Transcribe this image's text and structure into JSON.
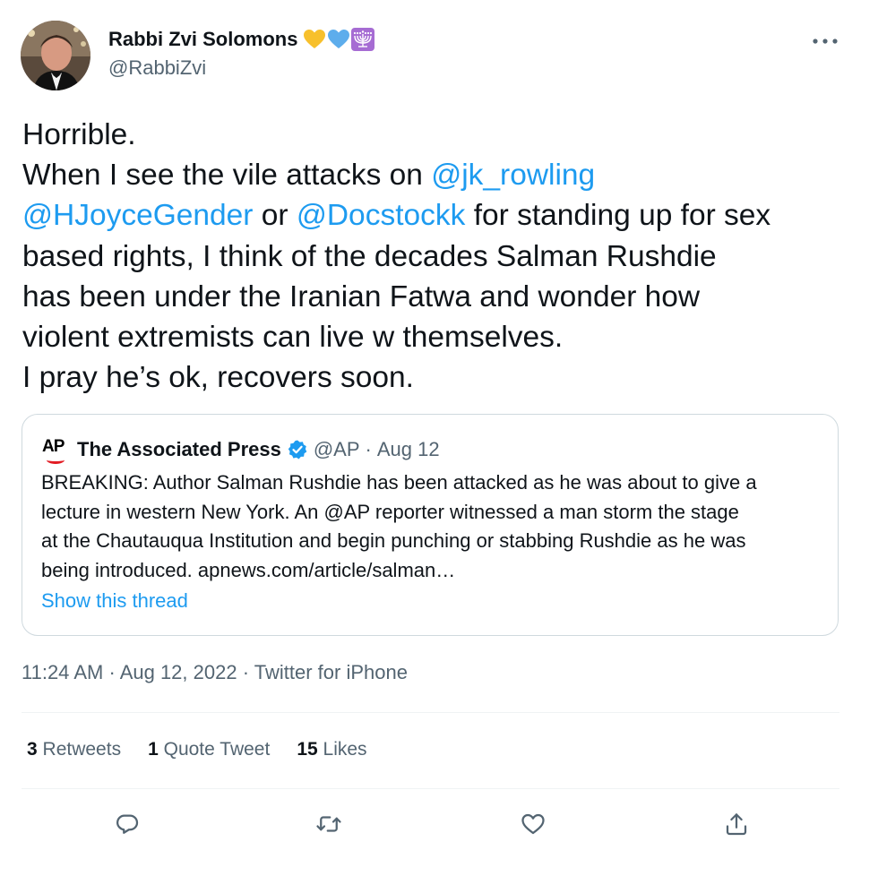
{
  "author": {
    "name": "Rabbi Zvi Solomons",
    "handle": "@RabbiZvi",
    "badges": [
      "yellow-heart-icon",
      "blue-heart-icon",
      "menorah-icon"
    ]
  },
  "tweet": {
    "lines": [
      [
        {
          "t": "Horrible."
        }
      ],
      [
        {
          "t": "When I see the vile attacks on "
        },
        {
          "t": "@jk_rowling",
          "m": true
        }
      ],
      [
        {
          "t": "@HJoyceGender",
          "m": true
        },
        {
          "t": " or "
        },
        {
          "t": "@Docstockk",
          "m": true
        },
        {
          "t": " for standing up for sex"
        }
      ],
      [
        {
          "t": "based rights, I think of the decades Salman Rushdie"
        }
      ],
      [
        {
          "t": "has been under the Iranian Fatwa and wonder how"
        }
      ],
      [
        {
          "t": "violent extremists can live w themselves."
        }
      ],
      [
        {
          "t": "I pray he’s ok, recovers soon."
        }
      ]
    ]
  },
  "quote": {
    "logo_text": "AP",
    "name": "The Associated Press",
    "handle": "@AP",
    "separator": "·",
    "date": "Aug 12",
    "body_lines": [
      "BREAKING: Author Salman Rushdie has been attacked as he was about to give a",
      "lecture in western New York.  An @AP reporter witnessed a man storm the stage",
      "at the Chautauqua Institution and begin punching or stabbing Rushdie as he was",
      "being introduced. apnews.com/article/salman…"
    ],
    "show_thread": "Show this thread"
  },
  "meta": {
    "time": "11:24 AM",
    "separator": "·",
    "date": "Aug 12, 2022",
    "source": "Twitter for iPhone"
  },
  "stats": {
    "retweets": {
      "count": "3",
      "label": "Retweets"
    },
    "quotes": {
      "count": "1",
      "label": "Quote Tweet"
    },
    "likes": {
      "count": "15",
      "label": "Likes"
    }
  },
  "actions": [
    "reply-icon",
    "retweet-icon",
    "like-icon",
    "share-icon"
  ],
  "colors": {
    "accent": "#1d9bf0",
    "text": "#0f1419",
    "secondary": "#536471",
    "border": "#cfd9de",
    "yellow_heart": "#f7c02c",
    "blue_heart": "#5dadec",
    "menorah_bg": "#a66cd3",
    "ap_red": "#e21b23"
  }
}
